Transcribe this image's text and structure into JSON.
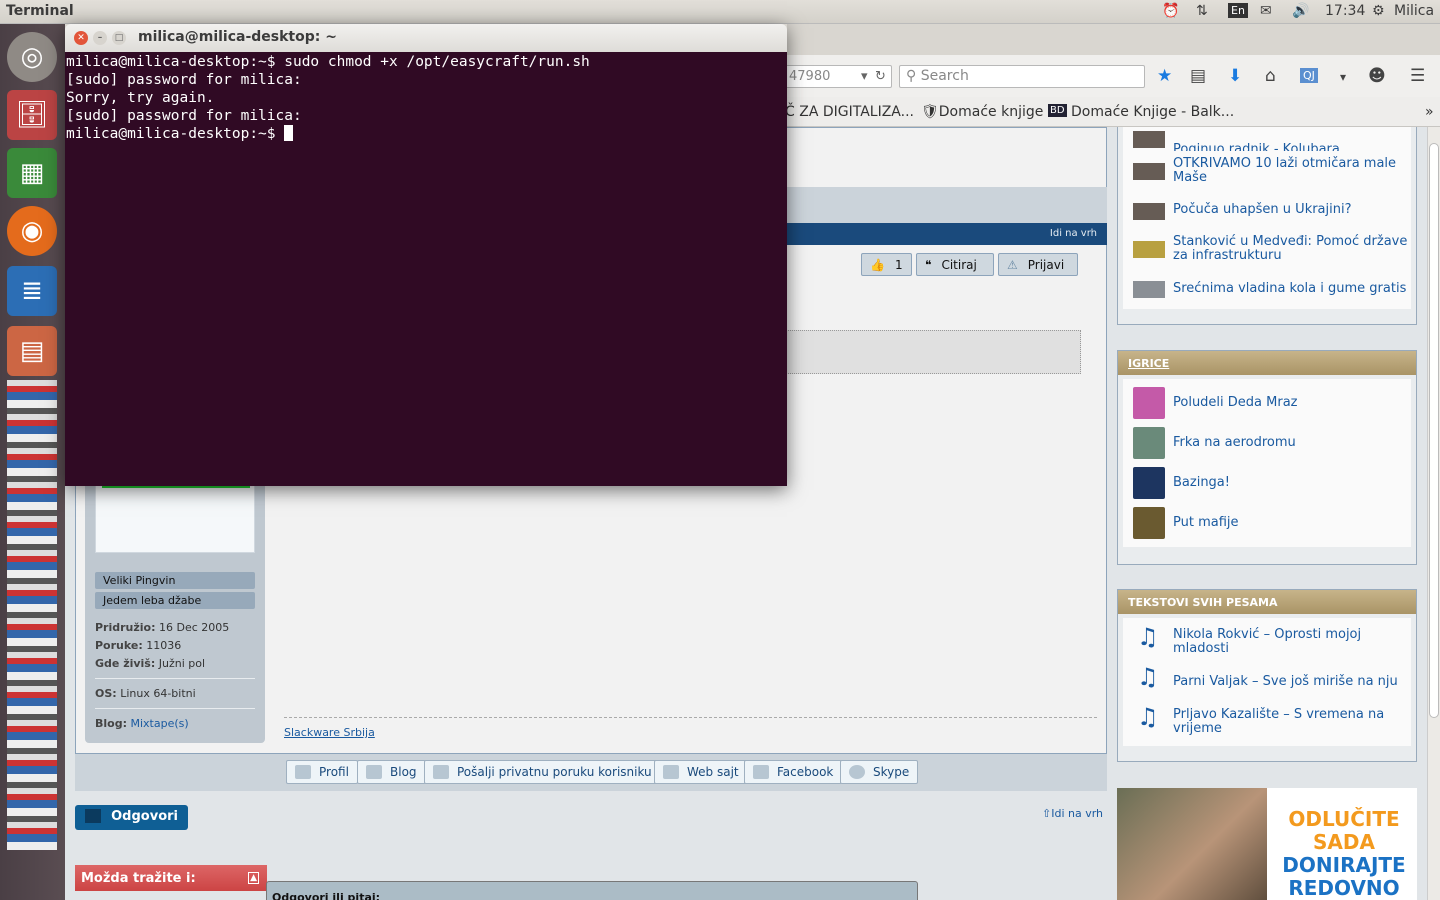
{
  "panel": {
    "app": "Terminal",
    "lang": "En",
    "time": "17:34",
    "user": "Milica"
  },
  "launcher": [
    "ubuntu-dash",
    "files",
    "calc",
    "firefox",
    "writer",
    "impress",
    "software-center",
    "amazon",
    "stack",
    "stack2",
    "stack3",
    "stack4"
  ],
  "browser": {
    "url_partial": "47980",
    "search_placeholder": "Search",
    "bookmarks": [
      "Č ZA DIGITALIZA...",
      "Domaće knjige",
      "Domaće Knjige - Balk..."
    ],
    "more": "»"
  },
  "terminal": {
    "title": "milica@milica-desktop: ~",
    "lines": [
      "milica@milica-desktop:~$ sudo chmod +x /opt/easycraft/run.sh",
      "[sudo] password for milica:",
      "Sorry, try again.",
      "[sudo] password for milica:",
      "milica@milica-desktop:~$ "
    ]
  },
  "post": {
    "go_top": "Idi na vrh",
    "like_count": "1",
    "quote": "Citiraj",
    "report": "Prijavi",
    "ranks": [
      "Veliki Pingvin",
      "Jedem leba džabe"
    ],
    "joined_label": "Pridružio:",
    "joined": "16 Dec 2005",
    "posts_label": "Poruke:",
    "posts": "11036",
    "loc_label": "Gde živiš:",
    "loc": "Južni pol",
    "os_label": "OS:",
    "os": "Linux 64-bitni",
    "blog_label": "Blog:",
    "blog": "Mixtape(s)",
    "signature": "Slackware Srbija",
    "buttons": [
      "Profil",
      "Blog",
      "Pošalji privatnu poruku korisniku",
      "Web sajt",
      "Facebook",
      "Skype"
    ]
  },
  "reply": "Odgovori",
  "go_top2": "Idi na vrh",
  "maybe": "Možda tražite i:",
  "reply_ask": "Odgovori ili pitaj:",
  "news": [
    "Poginuo radnik - Kolubara",
    "OTKRIVAMO 10 laži otmičara male Maše",
    "Počuča uhapšen u Ukrajini?",
    "Stanković u Medveđi: Pomoć države za infrastrukturu",
    "Srećnima vladina kola i gume gratis"
  ],
  "games": {
    "title": "IGRICE",
    "items": [
      "Poludeli Deda Mraz",
      "Frka na aerodromu",
      "Bazinga!",
      "Put mafije"
    ]
  },
  "lyrics": {
    "title": "TEKSTOVI SVIH PESAMA",
    "items": [
      "Nikola Rokvić – Oprosti mojoj mladosti",
      "Parni Valjak – Sve još miriše na nju",
      "Prljavo Kazalište – S vremena na vrijeme"
    ]
  },
  "ad": [
    "ODLUČITE",
    "SADA",
    "DONIRAJTE",
    "REDOVNO"
  ]
}
